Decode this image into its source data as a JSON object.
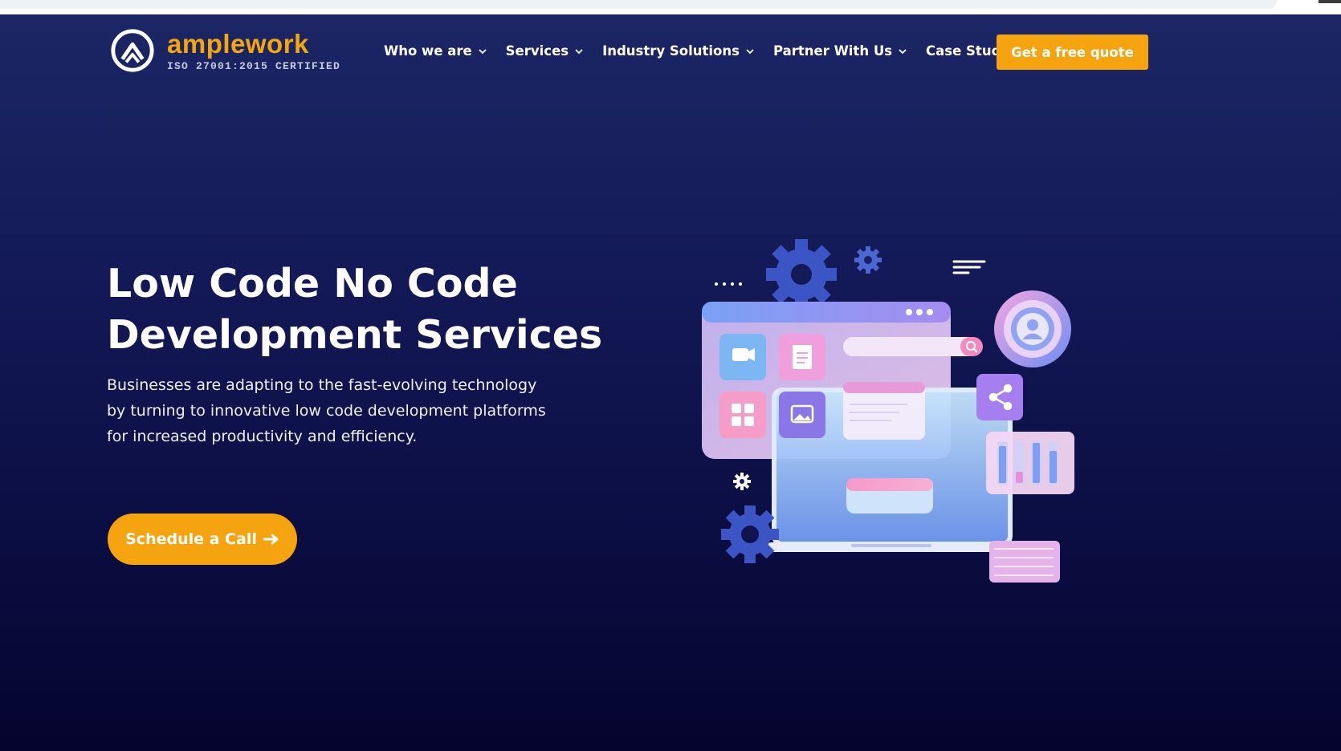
{
  "brand": {
    "name": "amplework",
    "certification": "ISO 27001:2015 CERTIFIED",
    "accent_color": "#f5a30e"
  },
  "nav": {
    "items": [
      {
        "label": "Who we are"
      },
      {
        "label": "Services"
      },
      {
        "label": "Industry Solutions"
      },
      {
        "label": "Partner With Us"
      },
      {
        "label": "Case Studies"
      }
    ],
    "quote_label": "Get a free quote"
  },
  "hero": {
    "title_line1": "Low Code No Code",
    "title_line2": "Development Services",
    "description": "Businesses are adapting to the fast-evolving technology by turning to innovative low code development platforms for increased productivity and efficiency.",
    "cta_label": "Schedule a Call"
  },
  "icons": {
    "logo": "amplework-logo-icon",
    "nav_chevron": "chevron-down-icon",
    "cta_arrow": "arrow-right-icon"
  }
}
